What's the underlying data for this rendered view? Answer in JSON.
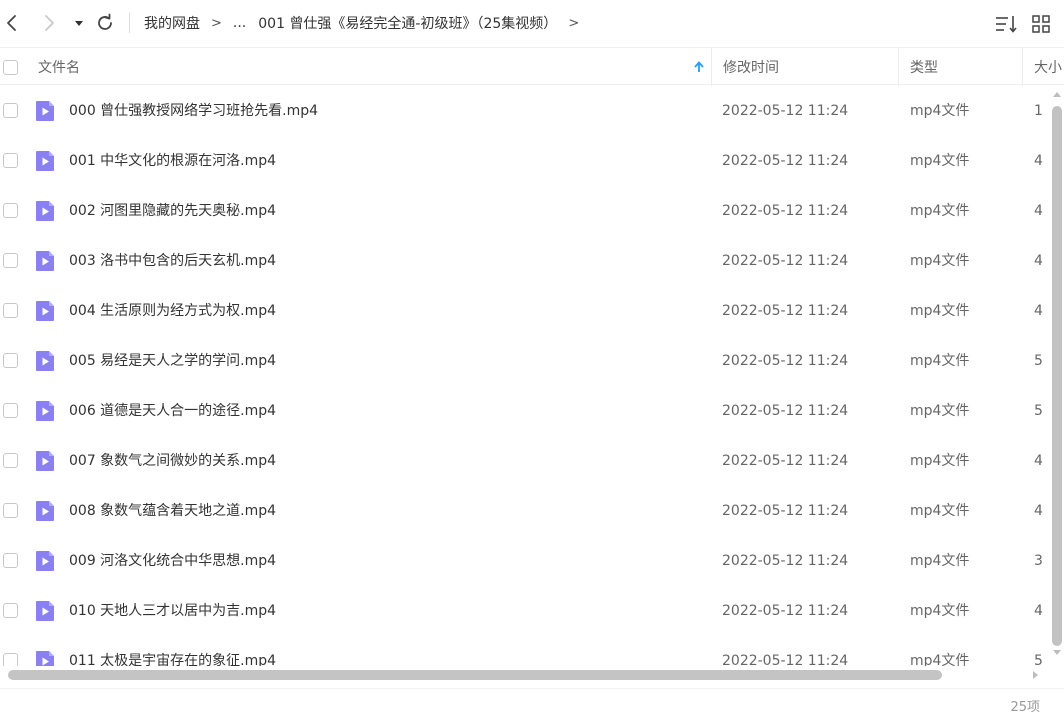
{
  "toolbar": {
    "breadcrumb_root": "我的网盘",
    "breadcrumb_ellipsis": "...",
    "breadcrumb_current": "001 曾仕强《易经完全通-初级班》（25集视频）",
    "separator": ">"
  },
  "header": {
    "name_label": "文件名",
    "modified_label": "修改时间",
    "type_label": "类型",
    "size_label": "大小"
  },
  "files": [
    {
      "name": "000 曾仕强教授网络学习班抢先看.mp4",
      "modified": "2022-05-12 11:24",
      "type": "mp4文件",
      "size": "1"
    },
    {
      "name": "001 中华文化的根源在河洛.mp4",
      "modified": "2022-05-12 11:24",
      "type": "mp4文件",
      "size": "4"
    },
    {
      "name": "002 河图里隐藏的先天奥秘.mp4",
      "modified": "2022-05-12 11:24",
      "type": "mp4文件",
      "size": "4"
    },
    {
      "name": "003 洛书中包含的后天玄机.mp4",
      "modified": "2022-05-12 11:24",
      "type": "mp4文件",
      "size": "4"
    },
    {
      "name": "004 生活原则为经方式为权.mp4",
      "modified": "2022-05-12 11:24",
      "type": "mp4文件",
      "size": "4"
    },
    {
      "name": "005 易经是天人之学的学问.mp4",
      "modified": "2022-05-12 11:24",
      "type": "mp4文件",
      "size": "5"
    },
    {
      "name": "006 道德是天人合一的途径.mp4",
      "modified": "2022-05-12 11:24",
      "type": "mp4文件",
      "size": "5"
    },
    {
      "name": "007 象数气之间微妙的关系.mp4",
      "modified": "2022-05-12 11:24",
      "type": "mp4文件",
      "size": "4"
    },
    {
      "name": "008 象数气蕴含着天地之道.mp4",
      "modified": "2022-05-12 11:24",
      "type": "mp4文件",
      "size": "4"
    },
    {
      "name": "009 河洛文化统合中华思想.mp4",
      "modified": "2022-05-12 11:24",
      "type": "mp4文件",
      "size": "3"
    },
    {
      "name": "010 天地人三才以居中为吉.mp4",
      "modified": "2022-05-12 11:24",
      "type": "mp4文件",
      "size": "4"
    },
    {
      "name": "011 太极是宇宙存在的象征.mp4",
      "modified": "2022-05-12 11:24",
      "type": "mp4文件",
      "size": "5"
    }
  ],
  "footer": {
    "item_count": "25项"
  },
  "icons": {
    "back": "chevron-left-icon",
    "forward": "chevron-right-icon",
    "history": "caret-down-icon",
    "refresh": "refresh-icon",
    "sort": "sort-icon",
    "view": "grid-view-icon",
    "file": "video-file-icon"
  },
  "colors": {
    "accent": "#2e9bef",
    "file_icon": "#8a80f2"
  }
}
